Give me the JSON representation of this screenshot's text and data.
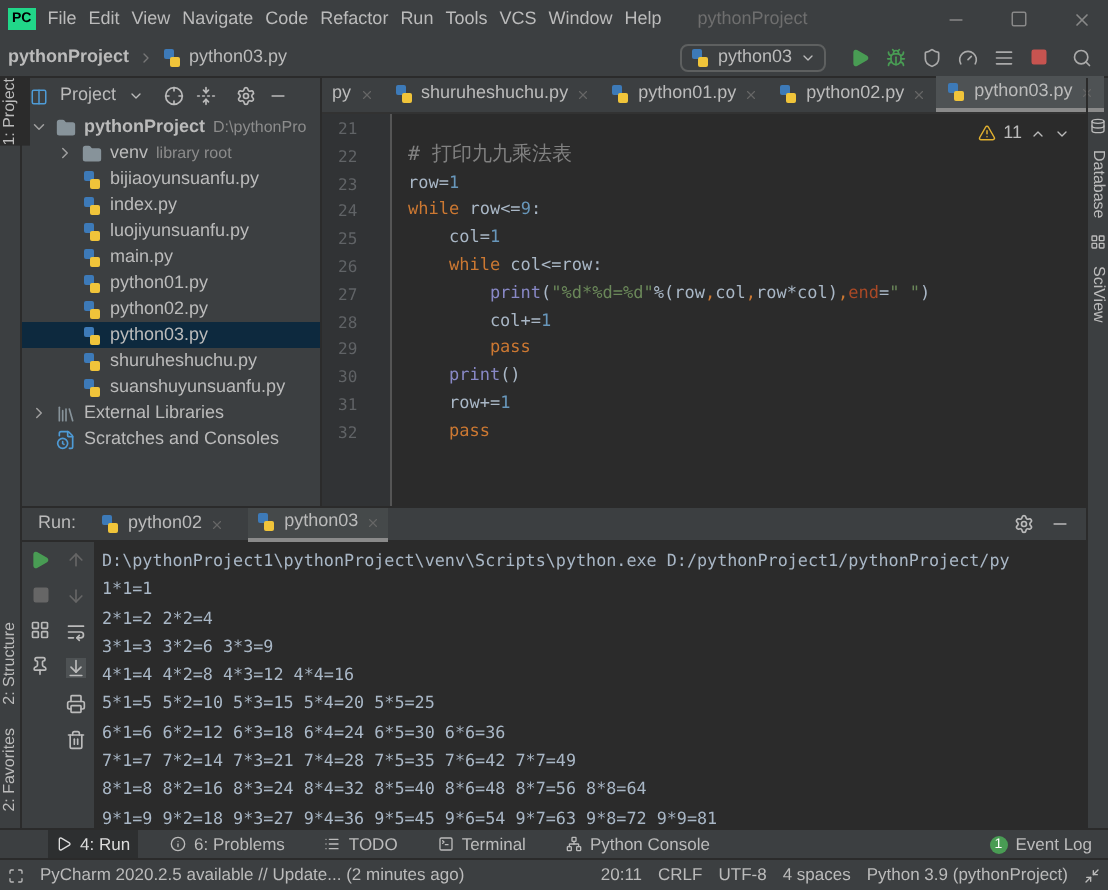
{
  "window": {
    "app_icon": "PC",
    "menu": [
      "File",
      "Edit",
      "View",
      "Navigate",
      "Code",
      "Refactor",
      "Run",
      "Tools",
      "VCS",
      "Window",
      "Help"
    ],
    "title": "pythonProject"
  },
  "breadcrumb": [
    "pythonProject",
    "python03.py"
  ],
  "run_config": "python03",
  "left_stripe": [
    "1: Project",
    "2: Structure",
    "2: Favorites"
  ],
  "right_stripe": [
    "Database",
    "SciView"
  ],
  "project_panel": {
    "title": "Project",
    "tree": [
      {
        "label": "pythonProject",
        "note": "D:\\pythonPro",
        "kind": "folder",
        "expanded": true,
        "selected": false,
        "children": [
          {
            "label": "venv",
            "note": "library root",
            "kind": "folder",
            "expanded": false,
            "selected": false
          },
          {
            "label": "bijiaoyunsuanfu.py",
            "kind": "file",
            "selected": false
          },
          {
            "label": "index.py",
            "kind": "file",
            "selected": false
          },
          {
            "label": "luojiyunsuanfu.py",
            "kind": "file",
            "selected": false
          },
          {
            "label": "main.py",
            "kind": "file",
            "selected": false
          },
          {
            "label": "python01.py",
            "kind": "file",
            "selected": false
          },
          {
            "label": "python02.py",
            "kind": "file",
            "selected": false
          },
          {
            "label": "python03.py",
            "kind": "file",
            "selected": true
          },
          {
            "label": "shuruheshuchu.py",
            "kind": "file",
            "selected": false
          },
          {
            "label": "suanshuyunsuanfu.py",
            "kind": "file",
            "selected": false
          }
        ]
      },
      {
        "label": "External Libraries",
        "kind": "library",
        "expanded": false,
        "selected": false
      },
      {
        "label": "Scratches and Consoles",
        "kind": "scratch",
        "selected": false
      }
    ]
  },
  "editor_tabs": [
    {
      "label": "py",
      "selected": false,
      "icon": false
    },
    {
      "label": "shuruheshuchu.py",
      "selected": false
    },
    {
      "label": "python01.py",
      "selected": false
    },
    {
      "label": "python02.py",
      "selected": false
    },
    {
      "label": "python03.py",
      "selected": true
    }
  ],
  "inspections": "11",
  "code_lines": [
    {
      "number": "21"
    },
    {
      "number": "22",
      "tokens": [
        {
          "text": "# 打印九九乘法表",
          "kind": "comment"
        }
      ]
    },
    {
      "number": "23",
      "tokens": [
        {
          "text": "row=",
          "kind": "id"
        },
        {
          "text": "1",
          "kind": "num"
        }
      ]
    },
    {
      "number": "24",
      "tokens": [
        {
          "text": "while",
          "kind": "kw"
        },
        {
          "text": " row<=",
          "kind": "id"
        },
        {
          "text": "9",
          "kind": "num"
        },
        {
          "text": ":",
          "kind": "id"
        }
      ]
    },
    {
      "number": "25",
      "tokens": [
        {
          "text": "    col=",
          "kind": "id"
        },
        {
          "text": "1",
          "kind": "num"
        }
      ]
    },
    {
      "number": "26",
      "tokens": [
        {
          "text": "    while",
          "kind": "kw"
        },
        {
          "text": " col<=row:",
          "kind": "id"
        }
      ]
    },
    {
      "number": "27",
      "tokens": [
        {
          "text": "        print",
          "kind": "fn"
        },
        {
          "text": "(",
          "kind": "id"
        },
        {
          "text": "\"%d*%d=%d\"",
          "kind": "str"
        },
        {
          "text": "%(row",
          "kind": "id"
        },
        {
          "text": ",",
          "kind": "kw"
        },
        {
          "text": "col",
          "kind": "id"
        },
        {
          "text": ",",
          "kind": "kw"
        },
        {
          "text": "row*col)",
          "kind": "id"
        },
        {
          "text": ",",
          "kind": "kw"
        },
        {
          "text": "end",
          "kind": "param"
        },
        {
          "text": "=",
          "kind": "id"
        },
        {
          "text": "\" \"",
          "kind": "str"
        },
        {
          "text": ")",
          "kind": "id"
        }
      ]
    },
    {
      "number": "28",
      "tokens": [
        {
          "text": "        col+=",
          "kind": "id"
        },
        {
          "text": "1",
          "kind": "num"
        }
      ]
    },
    {
      "number": "29",
      "tokens": [
        {
          "text": "        pass",
          "kind": "kw"
        }
      ]
    },
    {
      "number": "30",
      "tokens": [
        {
          "text": "    print",
          "kind": "fn"
        },
        {
          "text": "()",
          "kind": "id"
        }
      ]
    },
    {
      "number": "31",
      "tokens": [
        {
          "text": "    row+=",
          "kind": "id"
        },
        {
          "text": "1",
          "kind": "num"
        }
      ]
    },
    {
      "number": "32",
      "tokens": [
        {
          "text": "    pass",
          "kind": "kw"
        }
      ]
    }
  ],
  "run_panel": {
    "label": "Run:",
    "tabs": [
      {
        "label": "python02",
        "selected": false
      },
      {
        "label": "python03",
        "selected": true
      }
    ],
    "console": [
      "D:\\pythonProject1\\pythonProject\\venv\\Scripts\\python.exe D:/pythonProject1/pythonProject/py",
      "1*1=1",
      "2*1=2 2*2=4",
      "3*1=3 3*2=6 3*3=9",
      "4*1=4 4*2=8 4*3=12 4*4=16",
      "5*1=5 5*2=10 5*3=15 5*4=20 5*5=25",
      "6*1=6 6*2=12 6*3=18 6*4=24 6*5=30 6*6=36",
      "7*1=7 7*2=14 7*3=21 7*4=28 7*5=35 7*6=42 7*7=49",
      "8*1=8 8*2=16 8*3=24 8*4=32 8*5=40 8*6=48 8*7=56 8*8=64",
      "9*1=9 9*2=18 9*3=27 9*4=36 9*5=45 9*6=54 9*7=63 9*8=72 9*9=81"
    ]
  },
  "tool_windows": [
    {
      "label": "4: Run",
      "kind": "run",
      "selected": true
    },
    {
      "label": "6: Problems",
      "kind": "problems",
      "selected": false
    },
    {
      "label": "TODO",
      "kind": "todo",
      "selected": false
    },
    {
      "label": "Terminal",
      "kind": "terminal",
      "selected": false
    },
    {
      "label": "Python Console",
      "kind": "console",
      "selected": false
    }
  ],
  "event_log": {
    "label": "Event Log",
    "count": "1"
  },
  "status_bar": {
    "message": "PyCharm 2020.2.5 available // Update... (2 minutes ago)",
    "items": [
      "20:11",
      "CRLF",
      "UTF-8",
      "4 spaces",
      "Python 3.9 (pythonProject)"
    ]
  }
}
